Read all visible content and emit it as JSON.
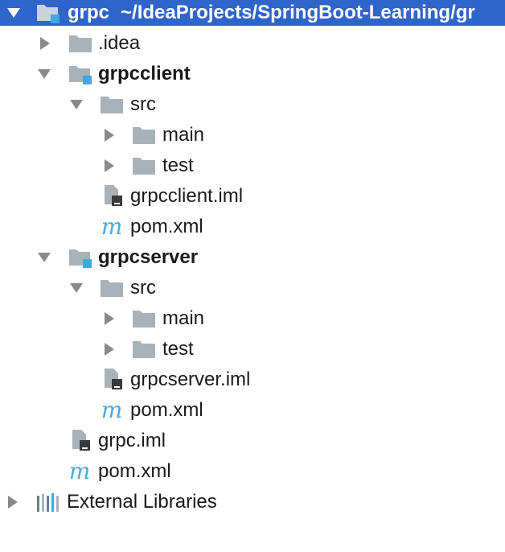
{
  "root": {
    "name": "grpc",
    "path": "~/IdeaProjects/SpringBoot-Learning/gr"
  },
  "items": [
    {
      "label": ".idea",
      "type": "folder"
    },
    {
      "label": "grpcclient",
      "type": "module"
    },
    {
      "label": "src",
      "type": "folder"
    },
    {
      "label": "main",
      "type": "folder"
    },
    {
      "label": "test",
      "type": "folder"
    },
    {
      "label": "grpcclient.iml",
      "type": "iml"
    },
    {
      "label": "pom.xml",
      "type": "maven"
    },
    {
      "label": "grpcserver",
      "type": "module"
    },
    {
      "label": "src",
      "type": "folder"
    },
    {
      "label": "main",
      "type": "folder"
    },
    {
      "label": "test",
      "type": "folder"
    },
    {
      "label": "grpcserver.iml",
      "type": "iml"
    },
    {
      "label": "pom.xml",
      "type": "maven"
    },
    {
      "label": "grpc.iml",
      "type": "iml"
    },
    {
      "label": "pom.xml",
      "type": "maven"
    },
    {
      "label": "External Libraries",
      "type": "libraries"
    }
  ],
  "icons": {
    "maven_glyph": "m",
    "folder": "folder-icon",
    "module": "module-folder-icon",
    "iml": "iml-file-icon",
    "maven": "maven-pom-icon",
    "libraries": "external-libraries-icon"
  },
  "colors": {
    "selection": "#2f65ca",
    "folder": "#a9b2b9",
    "module_badge": "#3fa9dc",
    "maven": "#4aa8e0",
    "arrow": "#8a8a8a"
  }
}
